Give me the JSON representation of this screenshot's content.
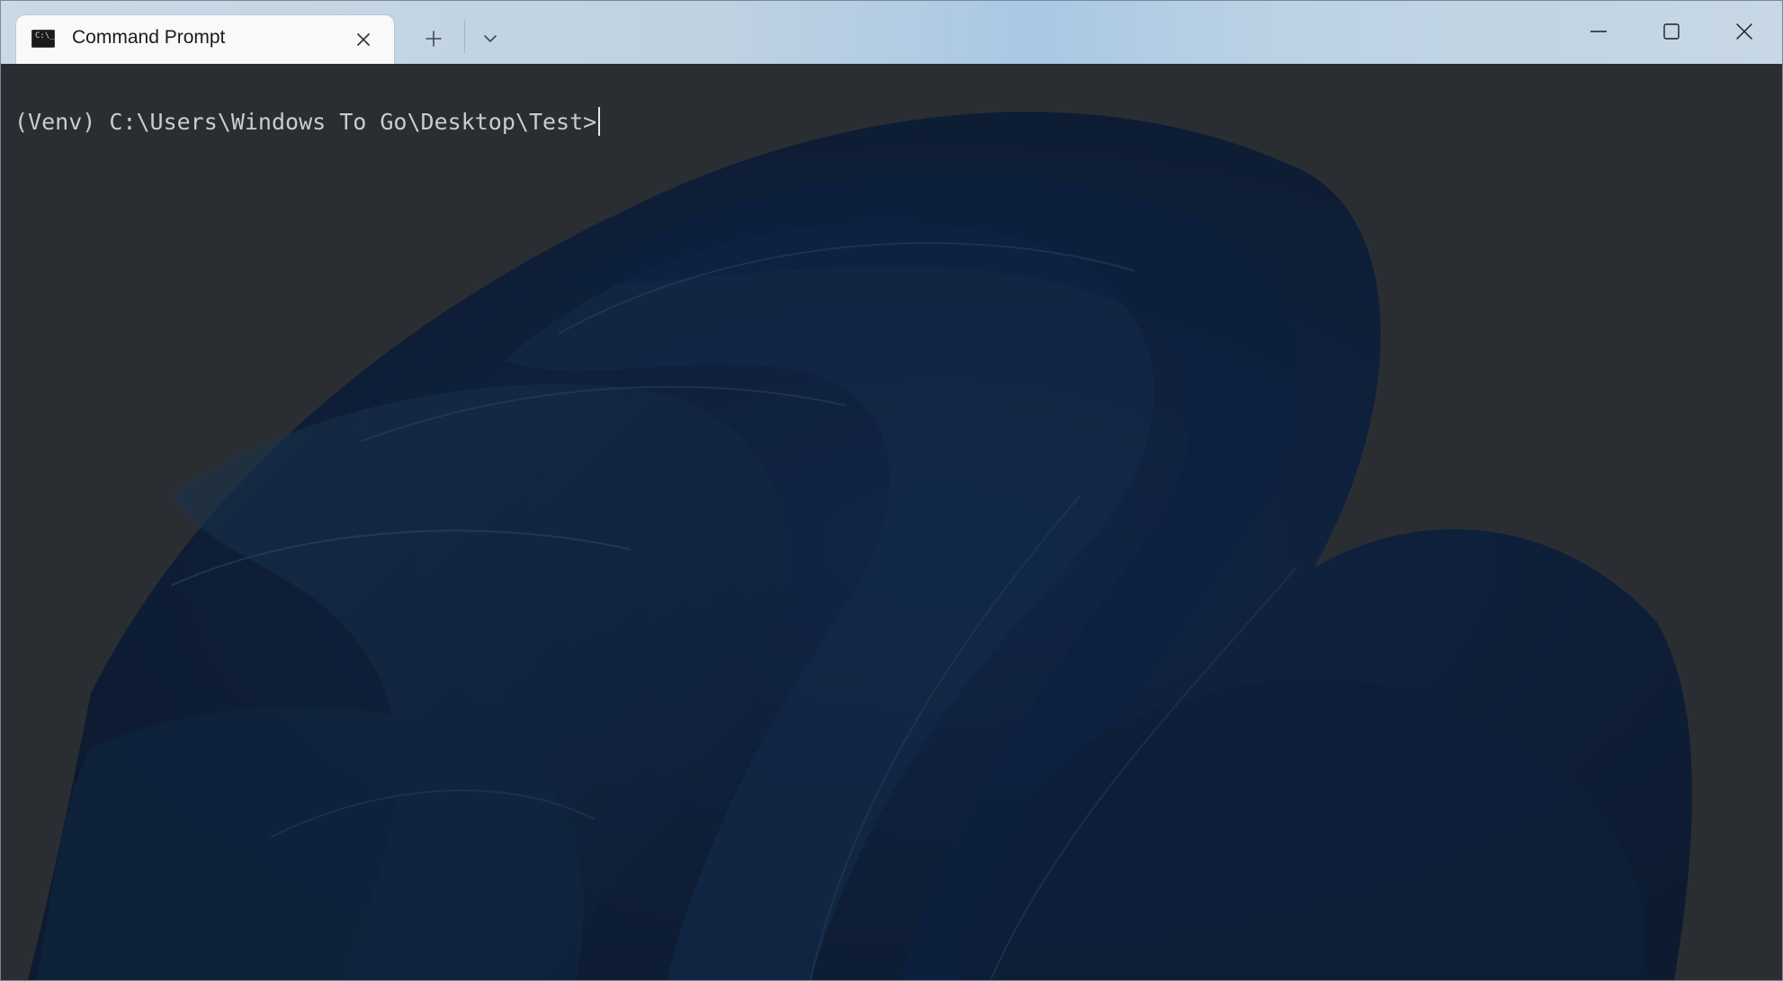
{
  "window": {
    "tab_title": "Command Prompt",
    "tab_icon": "console-app-icon",
    "tab_icon_glyph": "C:\\_"
  },
  "titlebar": {
    "new_tab_icon": "plus-icon",
    "dropdown_icon": "chevron-down-icon",
    "minimize_icon": "minimize-icon",
    "maximize_icon": "maximize-icon",
    "close_icon": "close-icon"
  },
  "terminal": {
    "prompt": "(Venv) C:\\Users\\Windows To Go\\Desktop\\Test>",
    "foreground_color": "#cccccc",
    "background_color": "#2a2e32",
    "wallpaper": "windows-11-bloom-dark"
  },
  "colors": {
    "titlebar_accent": "#a9c8e4",
    "tab_background": "#f9f9f9",
    "bloom_dark": "#0d1d36"
  }
}
